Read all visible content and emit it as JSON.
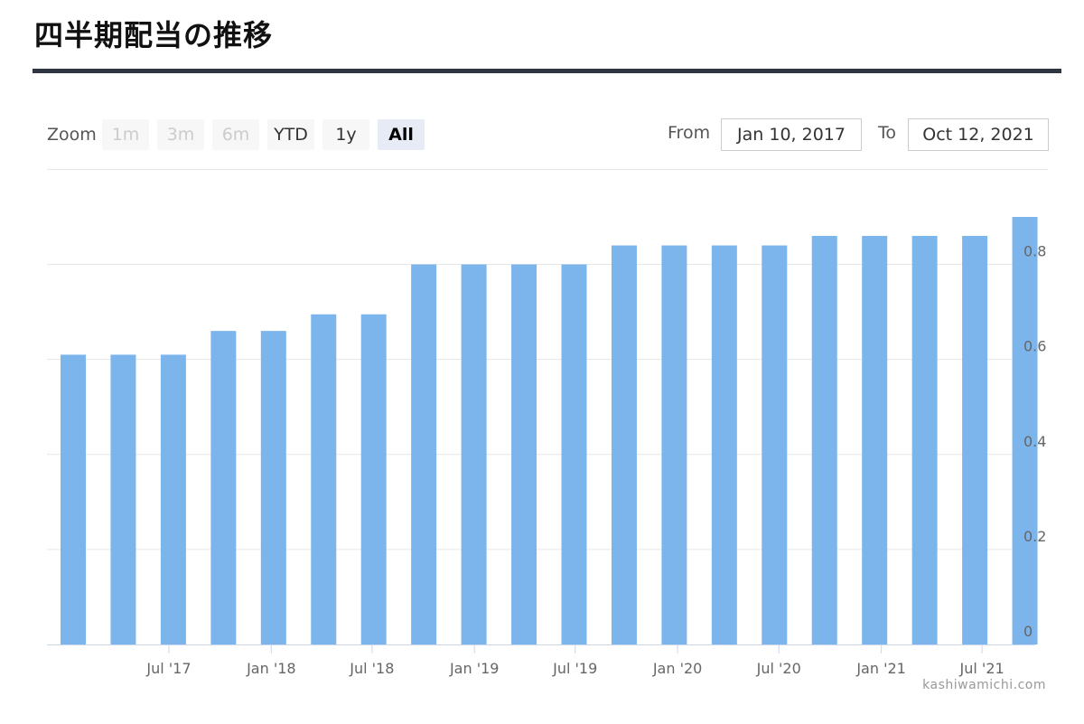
{
  "title": "四半期配当の推移",
  "toolbar": {
    "zoom_label": "Zoom",
    "zoom_buttons": [
      {
        "label": "1m",
        "state": "disabled"
      },
      {
        "label": "3m",
        "state": "disabled"
      },
      {
        "label": "6m",
        "state": "disabled"
      },
      {
        "label": "YTD",
        "state": "normal"
      },
      {
        "label": "1y",
        "state": "normal"
      },
      {
        "label": "All",
        "state": "selected"
      }
    ],
    "from_label": "From",
    "from_value": "Jan 10, 2017",
    "to_label": "To",
    "to_value": "Oct 12, 2021"
  },
  "credits": "kashiwamichi.com",
  "colors": {
    "bar": "#7cb5ec",
    "grid": "#e6e6e6",
    "axis_line": "#ccd6eb",
    "tick_label": "#666666"
  },
  "chart_data": {
    "type": "bar",
    "x": [
      "2017-01-10",
      "2017-04-10",
      "2017-07-10",
      "2017-10-10",
      "2018-01-10",
      "2018-04-10",
      "2018-07-10",
      "2018-10-10",
      "2019-01-10",
      "2019-04-10",
      "2019-07-10",
      "2019-10-10",
      "2020-01-10",
      "2020-04-10",
      "2020-07-10",
      "2020-10-10",
      "2021-01-10",
      "2021-04-10",
      "2021-07-10",
      "2021-10-10"
    ],
    "values": [
      0.61,
      0.61,
      0.61,
      0.66,
      0.66,
      0.695,
      0.695,
      0.8,
      0.8,
      0.8,
      0.8,
      0.84,
      0.84,
      0.84,
      0.84,
      0.86,
      0.86,
      0.86,
      0.86,
      0.9
    ],
    "ylim": [
      0,
      0.9
    ],
    "y_ticks": [
      "0",
      "0.2",
      "0.4",
      "0.6",
      "0.8"
    ],
    "x_tick_labels": [
      "Jul '17",
      "Jan '18",
      "Jul '18",
      "Jan '19",
      "Jul '19",
      "Jan '20",
      "Jul '20",
      "Jan '21",
      "Jul '21"
    ],
    "y_axis_side": "right",
    "grid": true,
    "legend": "none"
  }
}
